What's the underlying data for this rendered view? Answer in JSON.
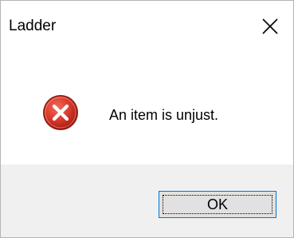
{
  "window": {
    "title": "Ladder",
    "close_icon": "close-icon"
  },
  "content": {
    "icon": "error-icon",
    "message": "An item is unjust."
  },
  "footer": {
    "ok_label": "OK"
  },
  "colors": {
    "error_red": "#c42b1c",
    "button_border": "#0078d7",
    "footer_bg": "#f0f0f0"
  }
}
